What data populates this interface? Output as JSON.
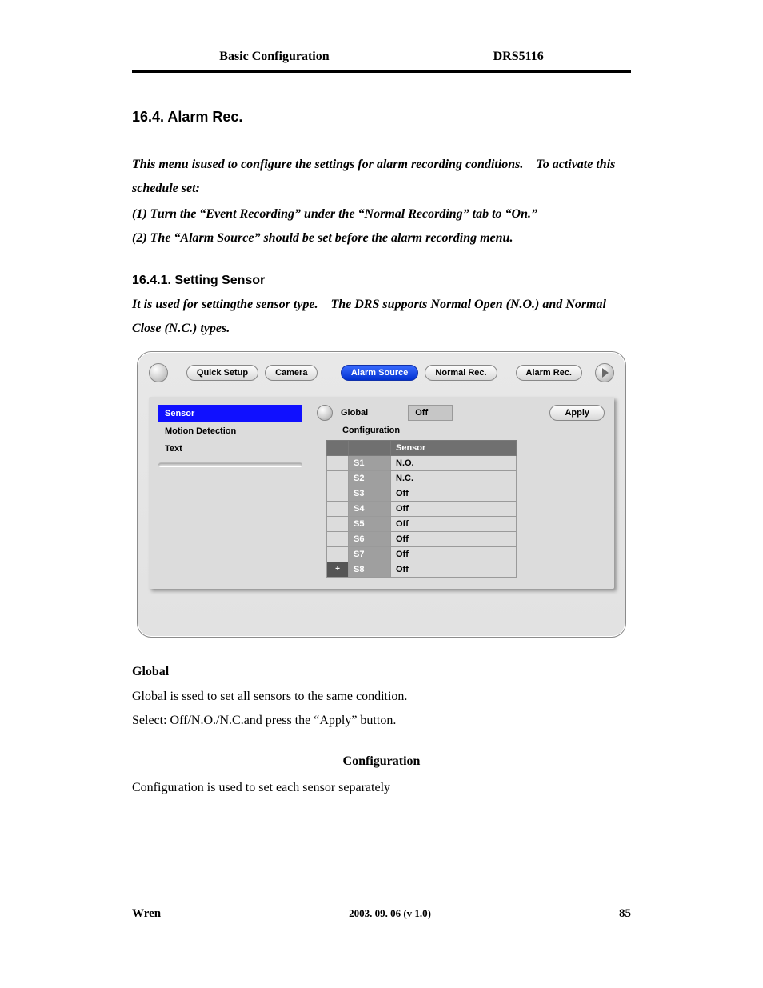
{
  "header": {
    "left": "Basic Configuration",
    "right": "DRS5116"
  },
  "section": {
    "number_title": "16.4. Alarm Rec.",
    "intro": "This menu isused to configure the settings for alarm recording conditions. To activate this schedule set:",
    "step1": "(1) Turn the “Event Recording” under the “Normal Recording” tab to “On.”",
    "step2": "(2) The “Alarm Source” should be set before the alarm recording menu."
  },
  "subsection": {
    "number_title": "16.4.1. Setting Sensor",
    "intro": "It is used for settingthe sensor type. The DRS supports Normal Open (N.O.) and Normal Close (N.C.) types."
  },
  "ui": {
    "tabs": {
      "quick_setup": "Quick Setup",
      "camera": "Camera",
      "alarm_source": "Alarm Source",
      "normal_rec": "Normal Rec.",
      "alarm_rec": "Alarm Rec."
    },
    "side": {
      "sensor": "Sensor",
      "motion_detection": "Motion Detection",
      "text": "Text"
    },
    "panel": {
      "global_label": "Global",
      "global_value": "Off",
      "apply": "Apply",
      "configuration_label": "Configuration",
      "table_header": "Sensor",
      "rows": [
        {
          "id": "S1",
          "val": "N.O."
        },
        {
          "id": "S2",
          "val": "N.C."
        },
        {
          "id": "S3",
          "val": "Off"
        },
        {
          "id": "S4",
          "val": "Off"
        },
        {
          "id": "S5",
          "val": "Off"
        },
        {
          "id": "S6",
          "val": "Off"
        },
        {
          "id": "S7",
          "val": "Off"
        },
        {
          "id": "S8",
          "val": "Off"
        }
      ],
      "plus": "+"
    }
  },
  "body": {
    "global_h": "Global",
    "global_p1": "Global is ssed to set all sensors to the same condition.",
    "global_p2": "Select: Off/N.O./N.C.and press the “Apply” button.",
    "config_h": "Configuration",
    "config_p": "Configuration is used to set each sensor separately"
  },
  "footer": {
    "brand": "Wren",
    "date": "2003. 09. 06 (v 1.0)",
    "page": "85"
  }
}
